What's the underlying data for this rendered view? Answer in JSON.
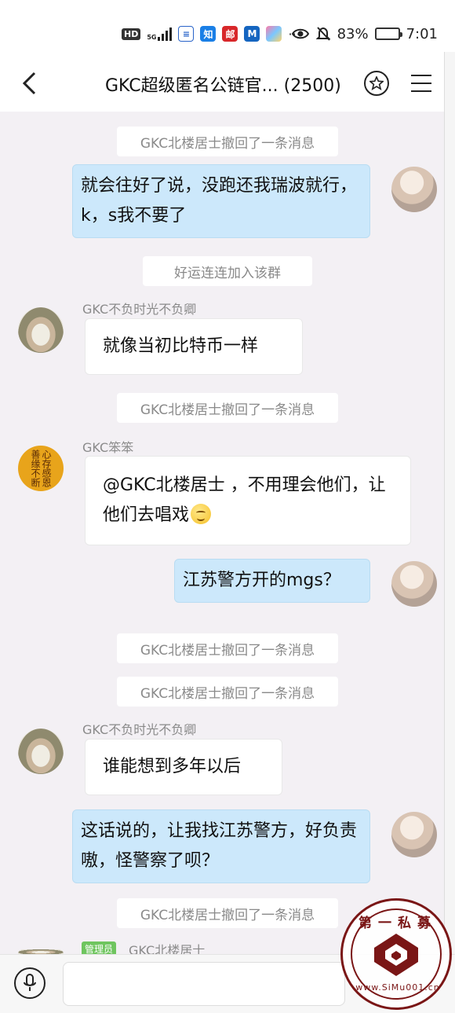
{
  "status_bar": {
    "hd": "HD",
    "net": "5G",
    "app_icons": [
      "equalizer-app-icon",
      "zhi-app-icon",
      "post-app-icon",
      "m-app-icon",
      "flower-app-icon"
    ],
    "zhi_label": "知",
    "post_label": "邮",
    "m_label": "M",
    "more": "···",
    "battery_percent": "83%",
    "battery_level": 0.83,
    "time": "7:01"
  },
  "header": {
    "title": "GKC超级匿名公链官...",
    "member_count": "(2500)"
  },
  "messages": {
    "sys1": "GKC北楼居士撤回了一条消息",
    "out1": "就会往好了说，没跑还我瑞波就行，k，s我不要了",
    "sys_join": "好运连连加入该群",
    "sender1": "GKC不负时光不负卿",
    "in1": "就像当初比特币一样",
    "sys2": "GKC北楼居士撤回了一条消息",
    "sender2": "GKC笨笨",
    "in2": "@GKC北楼居士 ，不用理会他们，让他们去唱戏",
    "out2": "江苏警方开的mgs？",
    "sys3": "GKC北楼居士撤回了一条消息",
    "sys4": "GKC北楼居士撤回了一条消息",
    "sender3": "GKC不负时光不负卿",
    "in3": "谁能想到多年以后",
    "out3": "这话说的，让我找江苏警方，好负责嗷，怪警察了呗？",
    "sys5": "GKC北楼居士撤回了一条消息",
    "admin_badge": "管理员",
    "sender4": "GKC北楼居士"
  },
  "avatar_callig": "心存感恩善缘不断",
  "input": {
    "placeholder": ""
  },
  "watermark": {
    "top": "第一私募",
    "bottom": "www.SiMu001.cn"
  },
  "colors": {
    "outgoing_bubble": "#cce8fb",
    "incoming_bubble": "#ffffff",
    "background": "#f3f0f4",
    "admin_badge": "#6fc55f",
    "watermark": "#7a1616"
  }
}
